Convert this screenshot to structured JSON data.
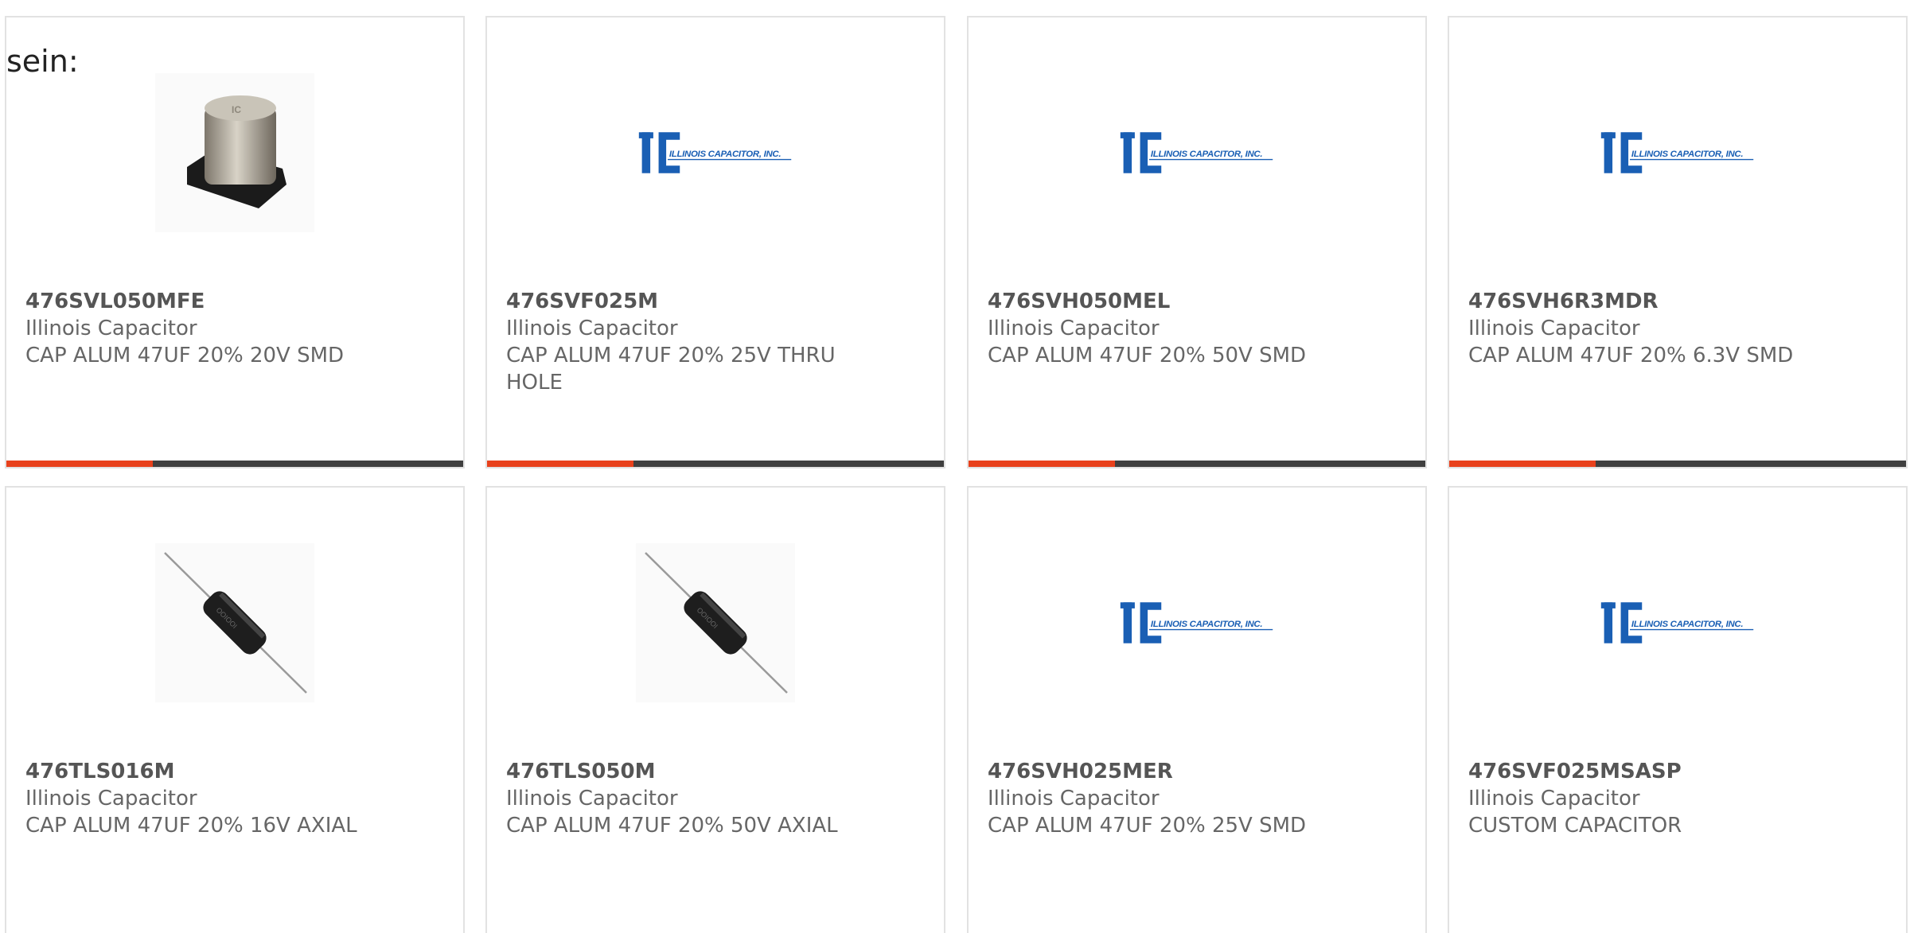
{
  "intro_text": "sein:",
  "brand_color": "#1a5fb4",
  "accent_color": "#e8411c",
  "products": [
    {
      "part_number": "476SVL050MFE",
      "manufacturer": "Illinois Capacitor",
      "description": "CAP ALUM 47UF 20% 20V SMD",
      "image": "smd-capacitor",
      "progress": 0.32
    },
    {
      "part_number": "476SVF025M",
      "manufacturer": "Illinois Capacitor",
      "description": "CAP ALUM 47UF 20% 25V THRU HOLE",
      "image": "illinois-capacitor-logo",
      "logo_text": "ILLINOIS CAPACITOR, INC.",
      "progress": 0.32
    },
    {
      "part_number": "476SVH050MEL",
      "manufacturer": "Illinois Capacitor",
      "description": "CAP ALUM 47UF 20% 50V SMD",
      "image": "illinois-capacitor-logo",
      "logo_text": "ILLINOIS CAPACITOR, INC.",
      "progress": 0.32
    },
    {
      "part_number": "476SVH6R3MDR",
      "manufacturer": "Illinois Capacitor",
      "description": "CAP ALUM 47UF 20% 6.3V SMD",
      "image": "illinois-capacitor-logo",
      "logo_text": "ILLINOIS CAPACITOR, INC.",
      "progress": 0.32
    },
    {
      "part_number": "476TLS016M",
      "manufacturer": "Illinois Capacitor",
      "description": "CAP ALUM 47UF 20% 16V AXIAL",
      "image": "axial-capacitor",
      "progress": null
    },
    {
      "part_number": "476TLS050M",
      "manufacturer": "Illinois Capacitor",
      "description": "CAP ALUM 47UF 20% 50V AXIAL",
      "image": "axial-capacitor",
      "progress": null
    },
    {
      "part_number": "476SVH025MER",
      "manufacturer": "Illinois Capacitor",
      "description": "CAP ALUM 47UF 20% 25V SMD",
      "image": "illinois-capacitor-logo",
      "logo_text": "ILLINOIS CAPACITOR, INC.",
      "progress": null
    },
    {
      "part_number": "476SVF025MSASP",
      "manufacturer": "Illinois Capacitor",
      "description": "CUSTOM CAPACITOR",
      "image": "illinois-capacitor-logo",
      "logo_text": "ILLINOIS CAPACITOR, INC.",
      "progress": null
    }
  ]
}
